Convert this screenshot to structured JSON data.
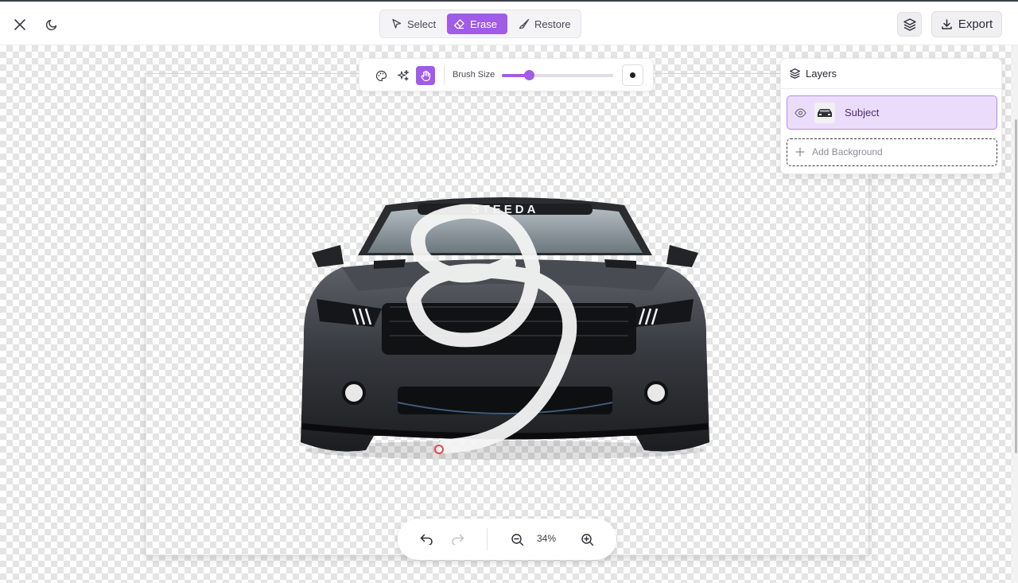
{
  "header": {
    "modes": [
      {
        "label": "Select",
        "active": false
      },
      {
        "label": "Erase",
        "active": true
      },
      {
        "label": "Restore",
        "active": false
      }
    ],
    "export_label": "Export"
  },
  "brush_toolbar": {
    "tools": [
      "palette-icon",
      "sparkles-icon",
      "hand-icon"
    ],
    "active_tool": "hand-icon",
    "brush_size_label": "Brush Size",
    "brush_size_fraction": 0.24
  },
  "layers": {
    "title": "Layers",
    "items": [
      {
        "name": "Subject",
        "visible": true
      }
    ],
    "add_background_label": "Add Background"
  },
  "canvas": {
    "windshield_text": "STEEDA"
  },
  "zoom": {
    "level": "34%"
  },
  "colors": {
    "accent": "#a05ce6",
    "layer_selected_bg": "#ecdcfb",
    "cursor": "#e5484d"
  }
}
